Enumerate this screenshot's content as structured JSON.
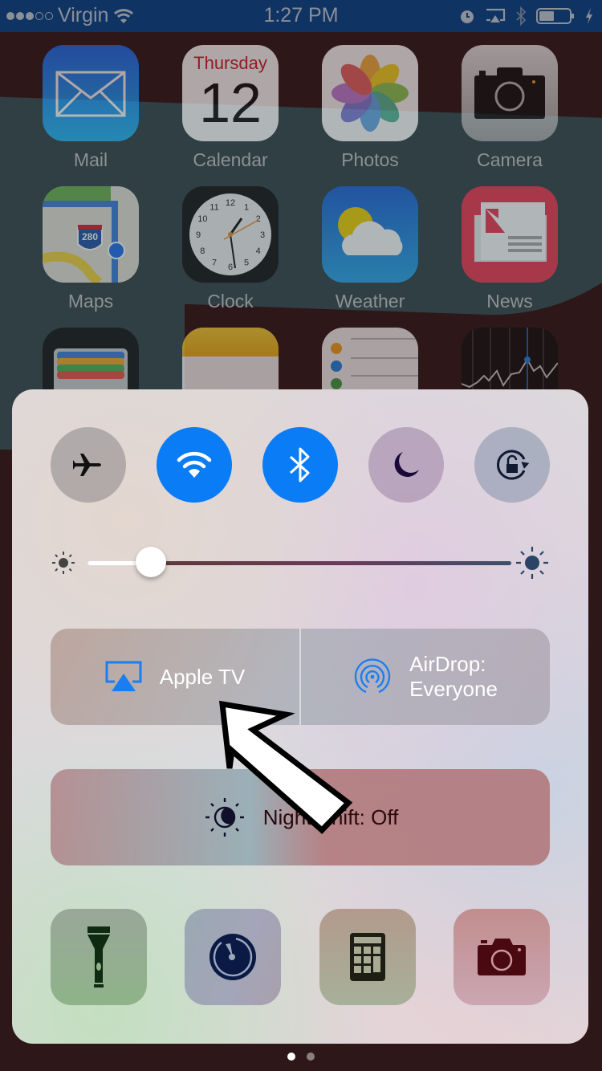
{
  "status_bar": {
    "signal_filled": 3,
    "signal_total": 5,
    "carrier": "Virgin",
    "time": "1:27 PM",
    "battery_level": 0.45,
    "icons": [
      "wifi-icon",
      "alarm-icon",
      "airplay-icon",
      "bluetooth-icon",
      "battery-icon",
      "charging-icon"
    ]
  },
  "home_screen": {
    "apps": [
      {
        "label": "Mail",
        "icon": "mail-icon"
      },
      {
        "label": "Calendar",
        "icon": "calendar-icon",
        "weekday": "Thursday",
        "day": "12"
      },
      {
        "label": "Photos",
        "icon": "photos-icon"
      },
      {
        "label": "Camera",
        "icon": "camera-icon"
      },
      {
        "label": "Maps",
        "icon": "maps-icon",
        "route": "280"
      },
      {
        "label": "Clock",
        "icon": "clock-icon"
      },
      {
        "label": "Weather",
        "icon": "weather-icon"
      },
      {
        "label": "News",
        "icon": "news-icon"
      },
      {
        "label": "",
        "icon": "wallet-icon"
      },
      {
        "label": "",
        "icon": "notes-icon"
      },
      {
        "label": "",
        "icon": "reminders-icon"
      },
      {
        "label": "",
        "icon": "stocks-icon"
      }
    ],
    "clock_numbers": [
      "12",
      "1",
      "2",
      "3",
      "4",
      "5",
      "6",
      "7",
      "8",
      "9",
      "10",
      "11"
    ]
  },
  "control_center": {
    "toggles": [
      {
        "name": "airplane-mode",
        "icon": "airplane-icon",
        "state": "off"
      },
      {
        "name": "wifi",
        "icon": "wifi-icon",
        "state": "on"
      },
      {
        "name": "bluetooth",
        "icon": "bluetooth-icon",
        "state": "on"
      },
      {
        "name": "do-not-disturb",
        "icon": "moon-icon",
        "state": "off"
      },
      {
        "name": "rotation-lock",
        "icon": "rotation-lock-icon",
        "state": "off"
      }
    ],
    "brightness": 0.12,
    "airplay": {
      "label": "Apple TV",
      "icon": "airplay-icon"
    },
    "airdrop": {
      "label_line1": "AirDrop:",
      "label_line2": "Everyone",
      "icon": "airdrop-icon"
    },
    "night_shift": {
      "label": "Night Shift: Off",
      "icon": "night-shift-icon"
    },
    "shortcuts": [
      {
        "name": "flashlight",
        "icon": "flashlight-icon"
      },
      {
        "name": "timer",
        "icon": "timer-icon"
      },
      {
        "name": "calculator",
        "icon": "calculator-icon"
      },
      {
        "name": "camera",
        "icon": "camera-icon"
      }
    ],
    "accent_color": "#0a7cf6"
  },
  "page_indicator": {
    "current": 1,
    "total": 2
  },
  "annotation": {
    "type": "arrow",
    "points_to": "Apple TV"
  }
}
